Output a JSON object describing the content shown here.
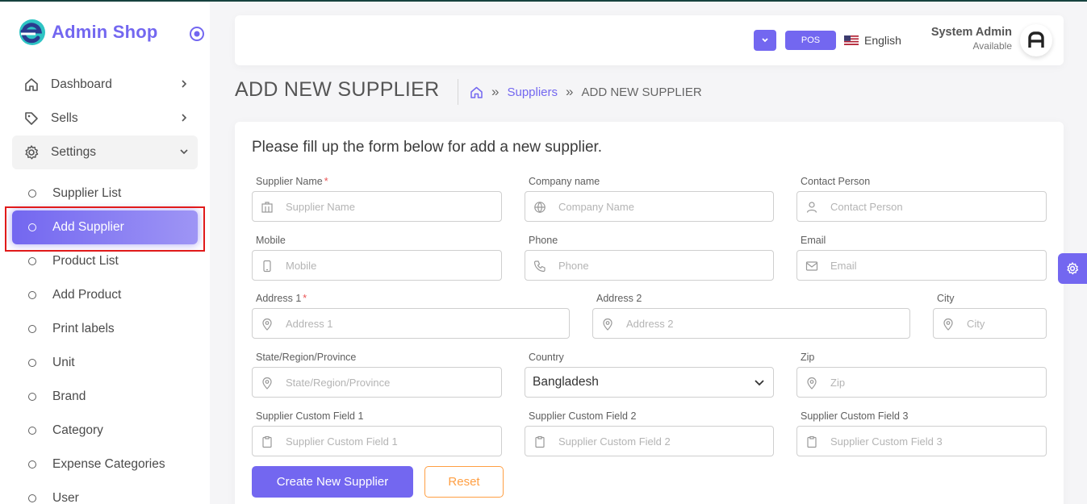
{
  "app": {
    "name": "Admin Shop"
  },
  "sidebar": {
    "menu": [
      {
        "label": "Dashboard",
        "icon": "home-icon"
      },
      {
        "label": "Sells",
        "icon": "tag-icon"
      },
      {
        "label": "Settings",
        "icon": "gear-icon"
      }
    ],
    "submenu": [
      {
        "label": "Supplier List"
      },
      {
        "label": "Add Supplier",
        "active": true
      },
      {
        "label": "Product List"
      },
      {
        "label": "Add Product"
      },
      {
        "label": "Print labels"
      },
      {
        "label": "Unit"
      },
      {
        "label": "Brand"
      },
      {
        "label": "Category"
      },
      {
        "label": "Expense Categories"
      },
      {
        "label": "User"
      }
    ]
  },
  "navbar": {
    "pos_label": "POS",
    "language": "English",
    "user_name": "System Admin",
    "user_status": "Available"
  },
  "page": {
    "title": "ADD NEW SUPPLIER",
    "breadcrumb": {
      "link": "Suppliers",
      "current": "ADD NEW SUPPLIER"
    }
  },
  "form": {
    "heading": "Please fill up the form below for add a new supplier.",
    "required_mark": "*",
    "fields": {
      "supplier_name": {
        "label": "Supplier Name",
        "placeholder": "Supplier Name"
      },
      "company_name": {
        "label": "Company name",
        "placeholder": "Company Name"
      },
      "contact_person": {
        "label": "Contact Person",
        "placeholder": "Contact Person"
      },
      "mobile": {
        "label": "Mobile",
        "placeholder": "Mobile"
      },
      "phone": {
        "label": "Phone",
        "placeholder": "Phone"
      },
      "email": {
        "label": "Email",
        "placeholder": "Email"
      },
      "address1": {
        "label": "Address 1",
        "placeholder": "Address 1"
      },
      "address2": {
        "label": "Address 2",
        "placeholder": "Address 2"
      },
      "city": {
        "label": "City",
        "placeholder": "City"
      },
      "state": {
        "label": "State/Region/Province",
        "placeholder": "State/Region/Province"
      },
      "country": {
        "label": "Country",
        "value": "Bangladesh"
      },
      "zip": {
        "label": "Zip",
        "placeholder": "Zip"
      },
      "custom1": {
        "label": "Supplier Custom Field 1",
        "placeholder": "Supplier Custom Field 1"
      },
      "custom2": {
        "label": "Supplier Custom Field 2",
        "placeholder": "Supplier Custom Field 2"
      },
      "custom3": {
        "label": "Supplier Custom Field 3",
        "placeholder": "Supplier Custom Field 3"
      }
    },
    "create_label": "Create New Supplier",
    "reset_label": "Reset"
  },
  "colors": {
    "accent": "#7367f0",
    "warning": "#ff9f43",
    "required": "#ea5455",
    "highlight": "#e11a1a"
  }
}
